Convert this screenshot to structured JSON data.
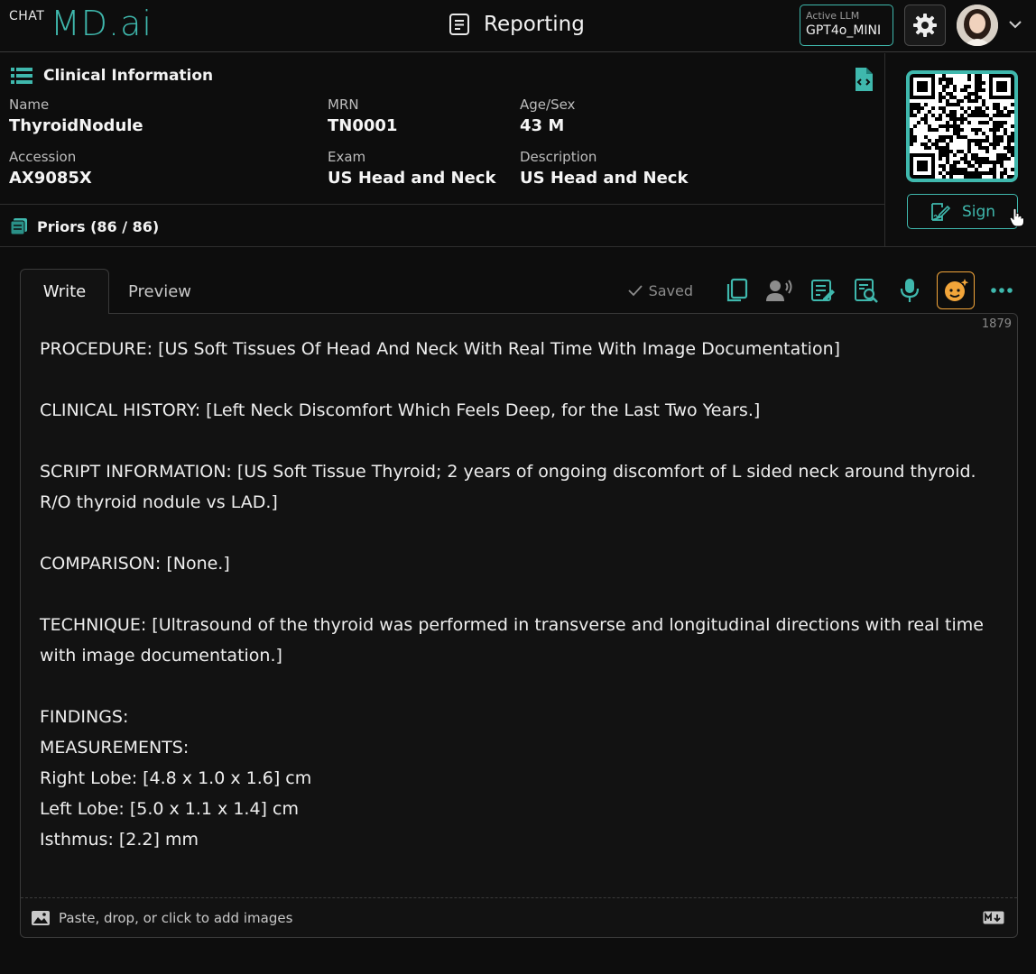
{
  "header": {
    "logo_prefix": "CHAT",
    "logo_main": "MD.ai",
    "title": "Reporting",
    "llm_label": "Active LLM",
    "llm_value": "GPT4o_MINI",
    "accent_color": "#3fb8ad"
  },
  "clinical": {
    "heading": "Clinical Information",
    "fields": [
      {
        "label": "Name",
        "value": "ThyroidNodule"
      },
      {
        "label": "MRN",
        "value": "TN0001"
      },
      {
        "label": "Age/Sex",
        "value": "43 M"
      },
      {
        "label": "Accession",
        "value": "AX9085X"
      },
      {
        "label": "Exam",
        "value": "US Head and Neck"
      },
      {
        "label": "Description",
        "value": "US Head and Neck"
      }
    ]
  },
  "priors": {
    "label": "Priors (86 / 86)"
  },
  "sign": {
    "label": "Sign"
  },
  "editor": {
    "tabs": [
      "Write",
      "Preview"
    ],
    "saved_label": "Saved",
    "char_count": "1879",
    "lines": [
      "PROCEDURE: [US Soft Tissues Of Head And Neck With Real Time With Image Documentation]",
      "",
      "CLINICAL HISTORY: [Left Neck Discomfort Which Feels Deep, for the Last Two Years.]",
      "",
      "SCRIPT INFORMATION: [US Soft Tissue Thyroid; 2 years of ongoing discomfort of L sided neck around thyroid. R/O thyroid nodule vs LAD.]",
      "",
      "COMPARISON: [None.]",
      "",
      "TECHNIQUE: [Ultrasound of the thyroid was performed in transverse and longitudinal directions with real time with image documentation.]",
      "",
      "FINDINGS:",
      "MEASUREMENTS:",
      "Right Lobe: [4.8 x 1.0 x 1.6] cm",
      "Left Lobe: [5.0 x 1.1 x 1.4] cm",
      "Isthmus: [2.2] mm"
    ],
    "footer_text": "Paste, drop, or click to add images",
    "md_badge": "M↓"
  }
}
